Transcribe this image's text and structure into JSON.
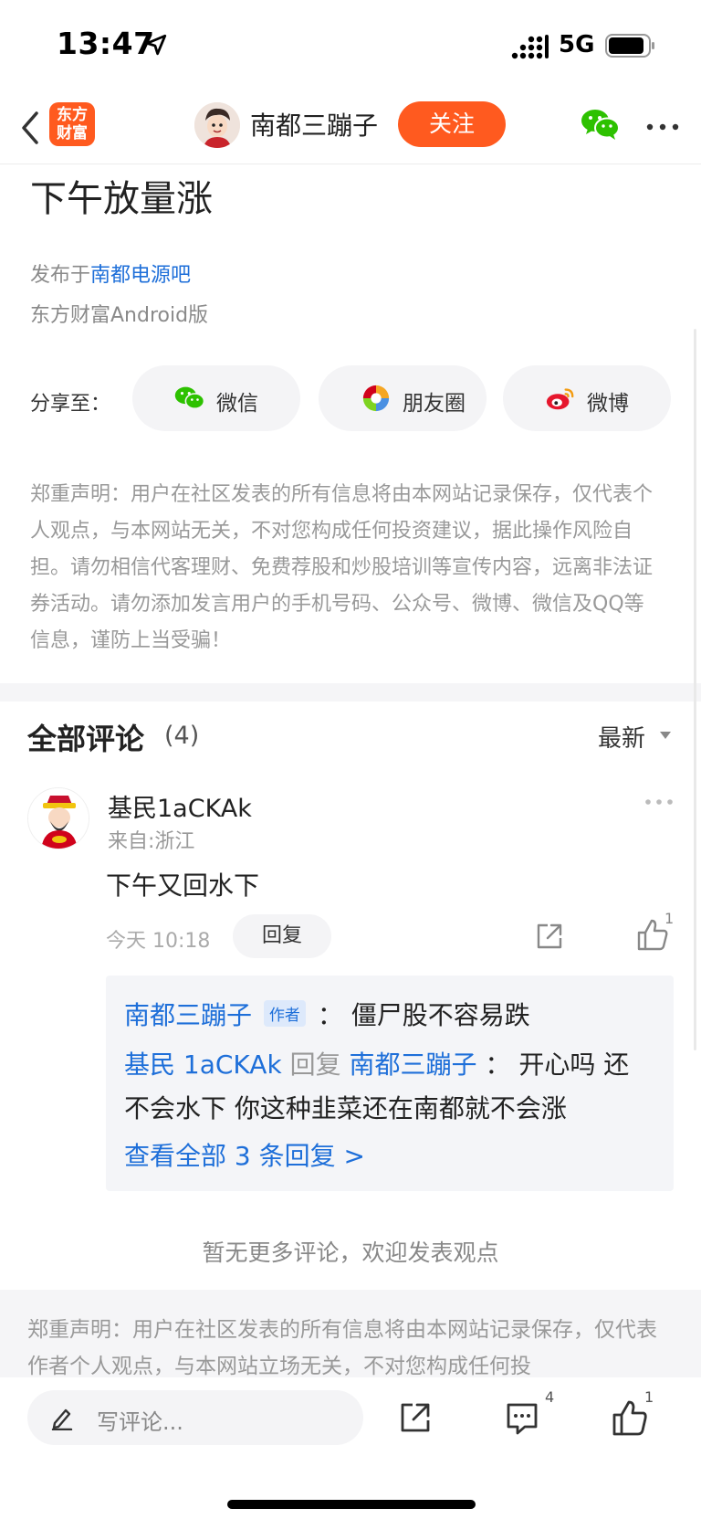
{
  "status": {
    "time": "13:47",
    "network": "5G"
  },
  "header": {
    "logo_line1": "东方",
    "logo_line2": "财富",
    "author": "南都三蹦子",
    "follow": "关注"
  },
  "article": {
    "title": "下午放量涨",
    "publish_prefix": "发布于",
    "publish_bar": "南都电源吧",
    "client": "东方财富Android版"
  },
  "share": {
    "label": "分享至：",
    "buttons": [
      {
        "label": "微信",
        "icon": "wechat-icon"
      },
      {
        "label": "朋友圈",
        "icon": "moments-icon"
      },
      {
        "label": "微博",
        "icon": "weibo-icon"
      }
    ]
  },
  "disclaimer": "郑重声明：用户在社区发表的所有信息将由本网站记录保存，仅代表个人观点，与本网站无关，不对您构成任何投资建议，据此操作风险自担。请勿相信代客理财、免费荐股和炒股培训等宣传内容，远离非法证券活动。请勿添加发言用户的手机号码、公众号、微博、微信及QQ等信息，谨防上当受骗！",
  "comments": {
    "title": "全部评论",
    "count": "(4)",
    "sort": "最新",
    "items": [
      {
        "name": "基民1aCKAk",
        "from": "来自:浙江",
        "text": "下午又回水下",
        "time": "今天 10:18",
        "reply_label": "回复",
        "likes": "1",
        "replies": {
          "r1_name": "南都三蹦子",
          "r1_tag": "作者",
          "r1_sep": "：",
          "r1_text": "僵尸股不容易跌",
          "r2_name": "基民 1aCKAk",
          "r2_action": "回复",
          "r2_target": "南都三蹦子",
          "r2_sep": "：",
          "r2_text_a": "开心吗 还",
          "r2_text_b": "不会水下 你这种韭菜还在南都就不会涨",
          "view_all": "查看全部 3 条回复 >"
        }
      }
    ],
    "no_more": "暂无更多评论，欢迎发表观点"
  },
  "bottom_disclaimer": "郑重声明：用户在社区发表的所有信息将由本网站记录保存，仅代表作者个人观点，与本网站立场无关，不对您构成任何投",
  "bottombar": {
    "placeholder": "写评论...",
    "comment_count": "4",
    "like_count": "1"
  },
  "colors": {
    "accent": "#ff5a1f",
    "link": "#1e6fd9"
  }
}
